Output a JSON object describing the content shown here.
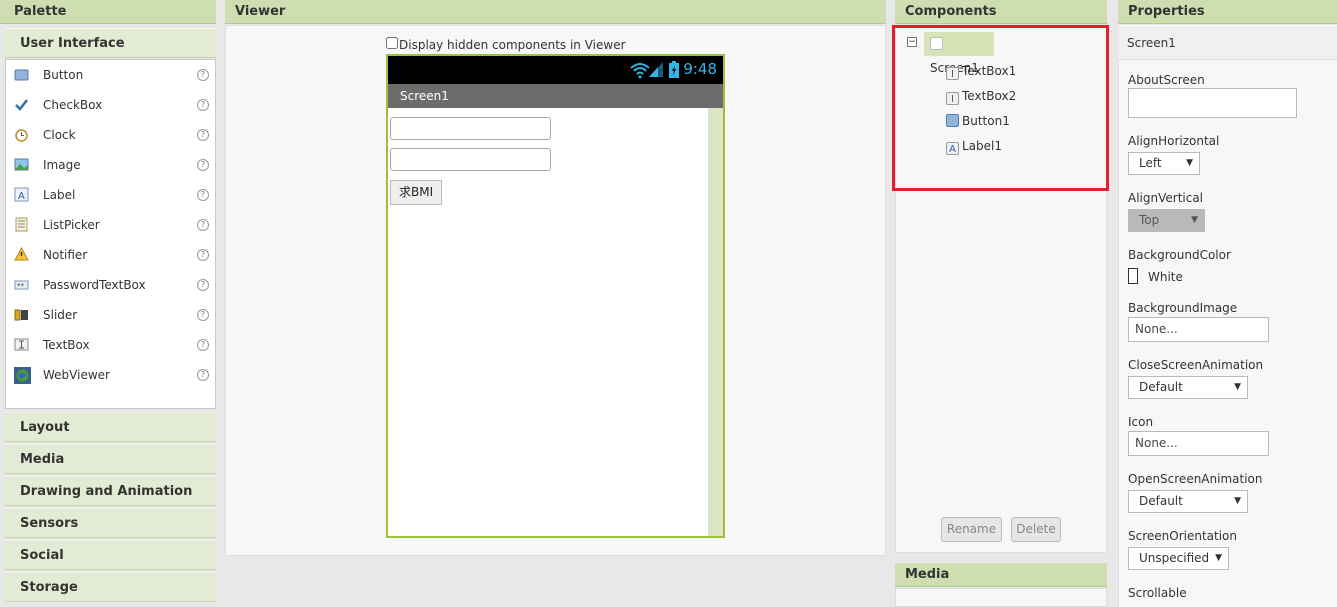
{
  "palette": {
    "header": "Palette",
    "open_category": "User Interface",
    "items": [
      {
        "label": "Button",
        "icon": "button-icon"
      },
      {
        "label": "CheckBox",
        "icon": "checkbox-icon"
      },
      {
        "label": "Clock",
        "icon": "clock-icon"
      },
      {
        "label": "Image",
        "icon": "image-icon"
      },
      {
        "label": "Label",
        "icon": "label-icon"
      },
      {
        "label": "ListPicker",
        "icon": "listpicker-icon"
      },
      {
        "label": "Notifier",
        "icon": "notifier-icon"
      },
      {
        "label": "PasswordTextBox",
        "icon": "password-icon"
      },
      {
        "label": "Slider",
        "icon": "slider-icon"
      },
      {
        "label": "TextBox",
        "icon": "textbox-icon"
      },
      {
        "label": "WebViewer",
        "icon": "webviewer-icon"
      }
    ],
    "help_glyph": "?",
    "categories": [
      "Layout",
      "Media",
      "Drawing and Animation",
      "Sensors",
      "Social",
      "Storage"
    ]
  },
  "viewer": {
    "header": "Viewer",
    "hidden_components_label": "Display hidden components in Viewer",
    "phone": {
      "clock": "9:48",
      "screen_title": "Screen1",
      "button_label": "求BMI"
    }
  },
  "components": {
    "header": "Components",
    "root": "Screen1",
    "toggle": "−",
    "children": [
      {
        "label": "TextBox1",
        "icon": "textbox-icon",
        "glyph": "I"
      },
      {
        "label": "TextBox2",
        "icon": "textbox-icon",
        "glyph": "I"
      },
      {
        "label": "Button1",
        "icon": "button-icon",
        "glyph": ""
      },
      {
        "label": "Label1",
        "icon": "label-icon",
        "glyph": "A"
      }
    ],
    "rename_label": "Rename",
    "delete_label": "Delete",
    "highlight_color": "#e0202d"
  },
  "media": {
    "header": "Media"
  },
  "properties": {
    "header": "Properties",
    "component_name": "Screen1",
    "about_screen": "AboutScreen",
    "align_horizontal": {
      "label": "AlignHorizontal",
      "value": "Left"
    },
    "align_vertical": {
      "label": "AlignVertical",
      "value": "Top"
    },
    "background_color": {
      "label": "BackgroundColor",
      "value": "White"
    },
    "background_image": {
      "label": "BackgroundImage",
      "value": "None..."
    },
    "close_screen_animation": {
      "label": "CloseScreenAnimation",
      "value": "Default"
    },
    "icon": {
      "label": "Icon",
      "value": "None..."
    },
    "open_screen_animation": {
      "label": "OpenScreenAnimation",
      "value": "Default"
    },
    "screen_orientation": {
      "label": "ScreenOrientation",
      "value": "Unspecified"
    },
    "scrollable": "Scrollable",
    "dropdown_arrow": "▼"
  }
}
